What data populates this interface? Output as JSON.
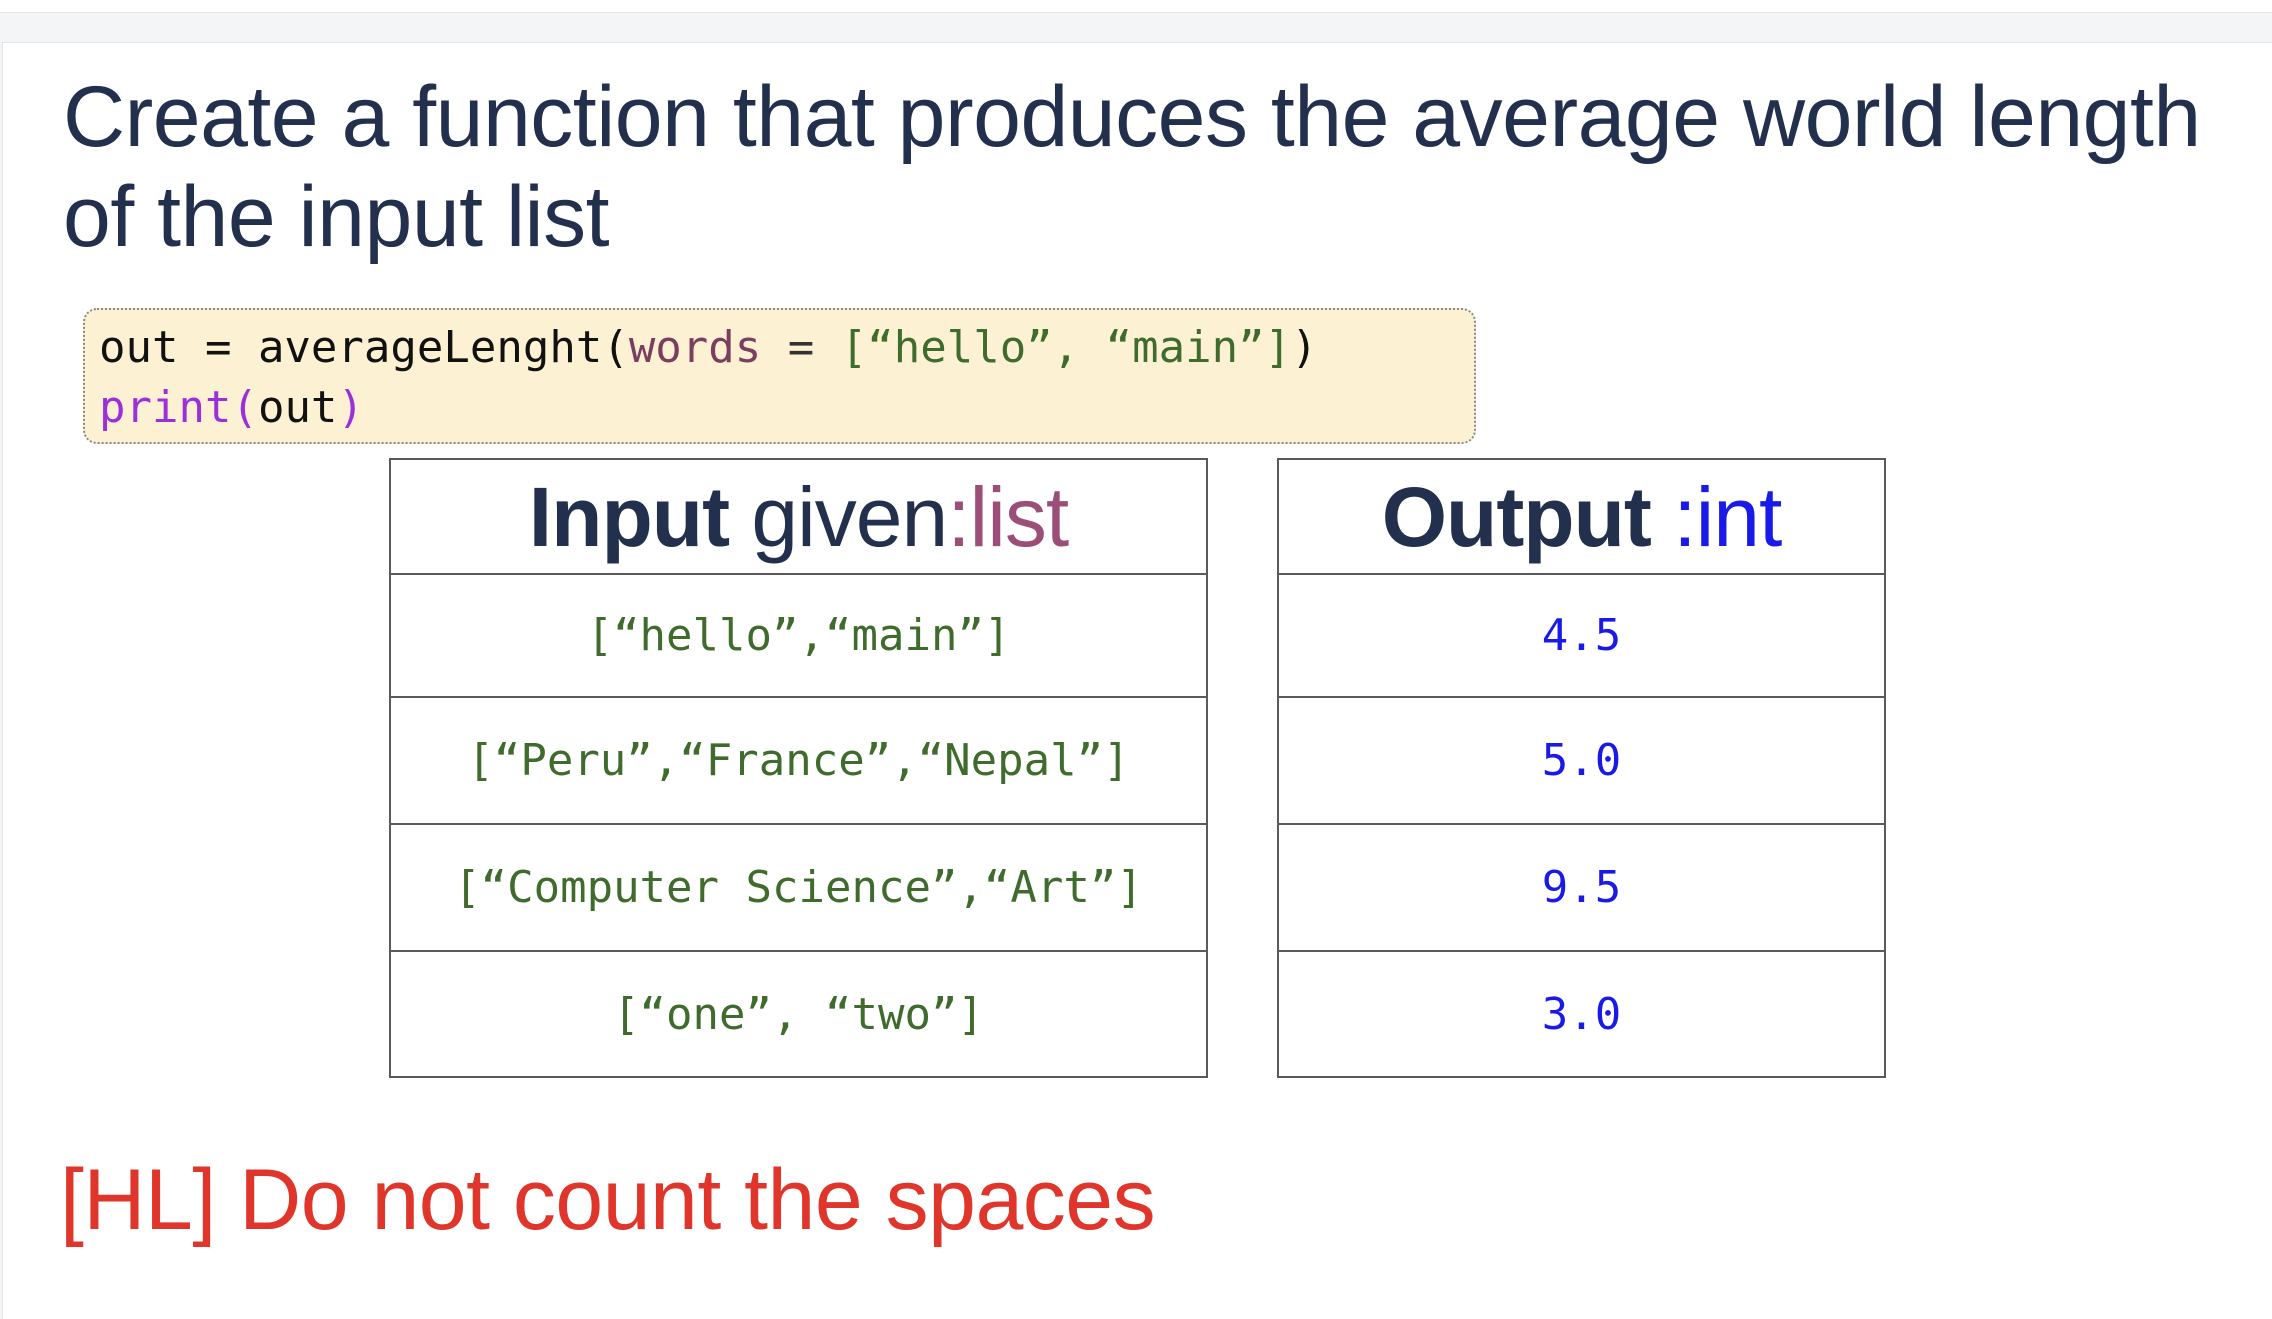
{
  "slide": {
    "title": "Create a function that produces the average world length of the input list",
    "code": {
      "line1": {
        "lhs": "out = averageLenght(",
        "param": "words",
        "eq": " = ",
        "value": "[“hello”, “main”]",
        "close": ")"
      },
      "line2": {
        "fn": "print(",
        "arg": "out",
        "close": ")"
      }
    },
    "input_table": {
      "header_bold": "Input",
      "header_plain": " given",
      "header_type": ":list",
      "rows": [
        "[“hello”,“main”]",
        "[“Peru”,“France”,“Nepal”]",
        "[“Computer Science”,“Art”]",
        "[“one”, “two”]"
      ]
    },
    "output_table": {
      "header_bold": "Output",
      "header_type": " :int",
      "rows": [
        "4.5",
        "5.0",
        "9.5",
        "3.0"
      ]
    },
    "note": "[HL] Do not count the spaces"
  },
  "colors": {
    "title": "#22304d",
    "code_bg": "#fdf1d3",
    "string": "#3f6b2c",
    "keyword": "#7a3e5f",
    "builtin": "#9b30d9",
    "list_type": "#9b4f78",
    "int_type": "#1a1ae8",
    "note": "#e0352b"
  }
}
